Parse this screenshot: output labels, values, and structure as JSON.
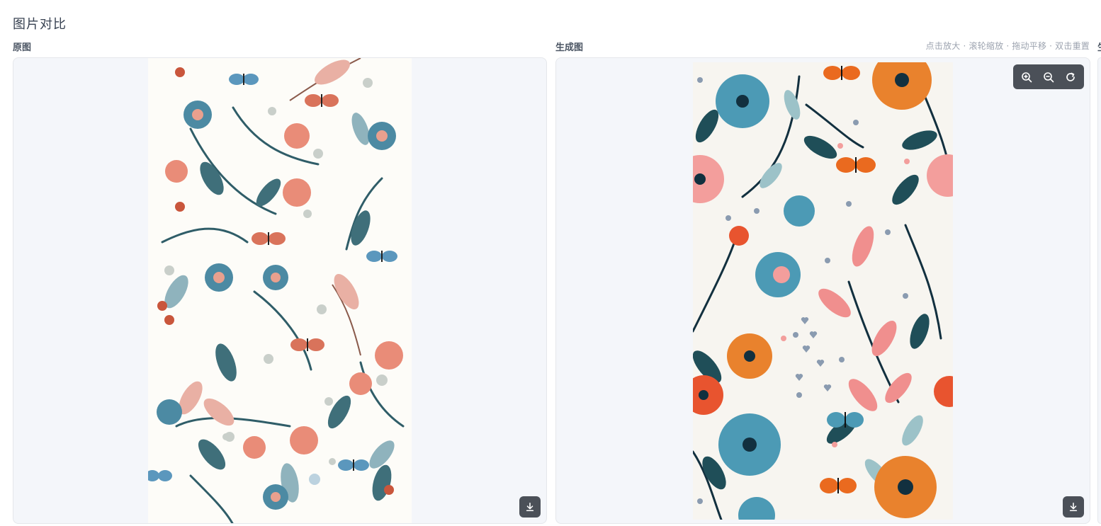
{
  "page": {
    "title": "图片对比"
  },
  "panels": {
    "original": {
      "label": "原图"
    },
    "generated": {
      "label": "生成图"
    },
    "third": {
      "label": "生"
    }
  },
  "viewer": {
    "hint": "点击放大 · 滚轮缩放 · 拖动平移 · 双击重置",
    "toolbar": [
      "zoom-in-icon",
      "zoom-out-icon",
      "reset-icon"
    ],
    "download_icon": "download-icon"
  },
  "colors": {
    "viewer_bg": "#f4f6fa",
    "button_bg": "#4b5058",
    "teal": "#3f6f7a",
    "coral": "#e98c78",
    "blue": "#4c9ab5",
    "orange": "#e9822d",
    "navy": "#12303f"
  }
}
